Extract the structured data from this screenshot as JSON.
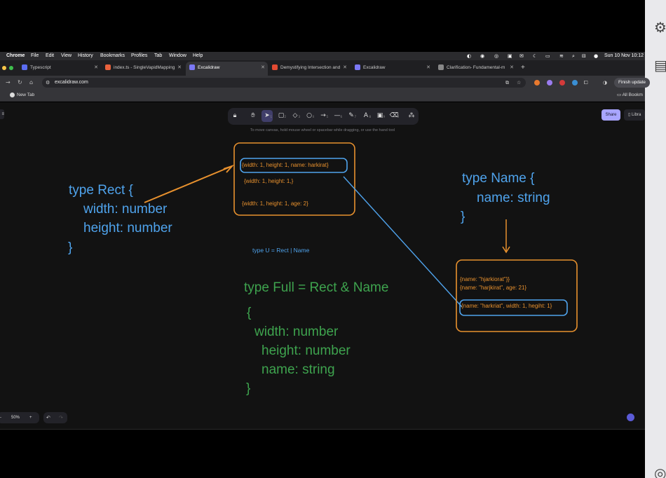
{
  "mac_menu": {
    "app": "Chrome",
    "items": [
      "File",
      "Edit",
      "View",
      "History",
      "Bookmarks",
      "Profiles",
      "Tab",
      "Window",
      "Help"
    ],
    "datetime": "Sun 10 Nov  10:12"
  },
  "tabs": [
    {
      "title": "Typescript",
      "favicon_color": "#5b6cf0",
      "active": false
    },
    {
      "title": "index.ts - SingleVapidMapping",
      "favicon_color": "#e8613c",
      "active": false
    },
    {
      "title": "Excalidraw",
      "favicon_color": "#7b78f5",
      "active": true
    },
    {
      "title": "Demystifying Intersection and",
      "favicon_color": "#e24a32",
      "active": false
    },
    {
      "title": "Excalidraw",
      "favicon_color": "#7b78f5",
      "active": false
    },
    {
      "title": "Clarification- Fundamental-m",
      "favicon_color": "#888888",
      "active": false
    }
  ],
  "toolbar": {
    "url": "excalidraw.com",
    "finish_update": "Finish update"
  },
  "bookmarks": {
    "new_tab": "New Tab",
    "all_bookmarks": "All Bookm"
  },
  "excalidraw": {
    "hint": "To move canvas, hold mouse wheel or spacebar while dragging, or use the hand tool",
    "share_label": "Share",
    "library_label": "Libra",
    "zoom_level": "50%",
    "zoom_out": "-",
    "zoom_in": "+",
    "tools": [
      {
        "icon": "lock-icon",
        "glyph": "🔒︎",
        "num": ""
      },
      {
        "icon": "hand-icon",
        "glyph": "✋︎",
        "num": ""
      },
      {
        "icon": "selection-icon",
        "glyph": "➤",
        "num": "1"
      },
      {
        "icon": "rectangle-icon",
        "glyph": "▢",
        "num": "2"
      },
      {
        "icon": "diamond-icon",
        "glyph": "◇",
        "num": "3"
      },
      {
        "icon": "ellipse-icon",
        "glyph": "○",
        "num": "4"
      },
      {
        "icon": "arrow-icon",
        "glyph": "→",
        "num": "5"
      },
      {
        "icon": "line-icon",
        "glyph": "—",
        "num": "6"
      },
      {
        "icon": "pencil-icon",
        "glyph": "✎",
        "num": "7"
      },
      {
        "icon": "text-icon",
        "glyph": "A",
        "num": "8"
      },
      {
        "icon": "image-icon",
        "glyph": "▣",
        "num": "9"
      },
      {
        "icon": "eraser-icon",
        "glyph": "⌫",
        "num": "0"
      },
      {
        "icon": "extra-tools-icon",
        "glyph": "⁂",
        "num": ""
      }
    ]
  },
  "drawing": {
    "rect_type": [
      "type Rect {",
      "width: number",
      "height: number",
      "}"
    ],
    "name_type": [
      "type Name {",
      "name: string",
      "}"
    ],
    "union_label": "type U = Rect | Name",
    "full_type": [
      "type Full = Rect & Name",
      "{",
      "width: number",
      "height: number",
      "name: string",
      "}"
    ],
    "rect_box": [
      "{width: 1, height: 1, name: harkirat}",
      "{width: 1, height: 1,}",
      "{width: 1, height: 1, age: 2}"
    ],
    "name_box": [
      "{name: \"hjarkiorat\"}}",
      "{name: \"harjkirat\", age: 21}",
      "{name: \"harkriat\", width: 1, hegiht: 1}"
    ],
    "colors": {
      "blue": "#4fa3ec",
      "green": "#3ea34e",
      "orange": "#e8912e"
    }
  }
}
